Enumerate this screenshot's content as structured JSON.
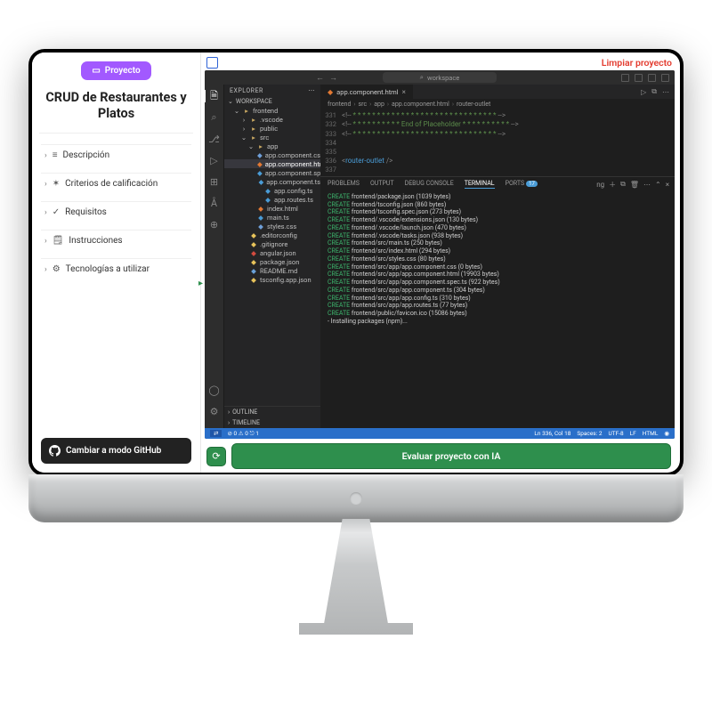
{
  "left": {
    "badge": "Proyecto",
    "title": "CRUD de Restaurantes y Platos",
    "items": [
      {
        "icon": "≡",
        "label": "Descripción"
      },
      {
        "icon": "✶",
        "label": "Criterios de calificación"
      },
      {
        "icon": "✓",
        "label": "Requisitos"
      },
      {
        "icon": "🗒",
        "label": "Instrucciones"
      },
      {
        "icon": "⚙",
        "label": "Tecnologías a utilizar"
      }
    ],
    "github_btn": "Cambiar a modo GitHub"
  },
  "top": {
    "limpiar": "Limpiar proyecto"
  },
  "vscode": {
    "search_placeholder": "workspace",
    "explorer_title": "EXPLORER",
    "workspace_label": "WORKSPACE",
    "outline_label": "OUTLINE",
    "timeline_label": "TIMELINE",
    "tree": [
      {
        "d": 1,
        "kind": "folder",
        "name": "frontend",
        "open": true
      },
      {
        "d": 2,
        "kind": "folder",
        "name": ".vscode",
        "open": false,
        "cls": "fi-fold"
      },
      {
        "d": 2,
        "kind": "folder",
        "name": "public",
        "open": false,
        "cls": "fi-fold"
      },
      {
        "d": 2,
        "kind": "folder",
        "name": "src",
        "open": true,
        "cls": "fi-fold"
      },
      {
        "d": 3,
        "kind": "folder",
        "name": "app",
        "open": true,
        "cls": "fi-fold"
      },
      {
        "d": 4,
        "kind": "file",
        "name": "app.component.css",
        "cls": "fi-css"
      },
      {
        "d": 4,
        "kind": "file",
        "name": "app.component.html",
        "cls": "fi-html",
        "sel": true
      },
      {
        "d": 4,
        "kind": "file",
        "name": "app.component.spec.ts",
        "cls": "fi-ts"
      },
      {
        "d": 4,
        "kind": "file",
        "name": "app.component.ts",
        "cls": "fi-ts"
      },
      {
        "d": 4,
        "kind": "file",
        "name": "app.config.ts",
        "cls": "fi-ts"
      },
      {
        "d": 4,
        "kind": "file",
        "name": "app.routes.ts",
        "cls": "fi-ts"
      },
      {
        "d": 3,
        "kind": "file",
        "name": "index.html",
        "cls": "fi-html"
      },
      {
        "d": 3,
        "kind": "file",
        "name": "main.ts",
        "cls": "fi-ts"
      },
      {
        "d": 3,
        "kind": "file",
        "name": "styles.css",
        "cls": "fi-css"
      },
      {
        "d": 2,
        "kind": "file",
        "name": ".editorconfig",
        "cls": "fi-json"
      },
      {
        "d": 2,
        "kind": "file",
        "name": ".gitignore",
        "cls": "fi-json"
      },
      {
        "d": 2,
        "kind": "file",
        "name": "angular.json",
        "cls": "fi-ng"
      },
      {
        "d": 2,
        "kind": "file",
        "name": "package.json",
        "cls": "fi-json"
      },
      {
        "d": 2,
        "kind": "file",
        "name": "README.md",
        "cls": "fi-md"
      },
      {
        "d": 2,
        "kind": "file",
        "name": "tsconfig.app.json",
        "cls": "fi-json"
      }
    ],
    "tab": {
      "label": "app.component.html"
    },
    "breadcrumb": [
      "frontend",
      "src",
      "app",
      "app.component.html",
      "router-outlet"
    ],
    "code": [
      {
        "n": "331",
        "html": "<span class='punct'>&lt;!--</span><span class='cmt'> * * * * * * * * * * * * * * * * * * * * * * * * * * * * * * </span><span class='punct'>--&gt;</span>"
      },
      {
        "n": "332",
        "html": "<span class='punct'>&lt;!--</span><span class='cmt'> * * * * * * * * * *  End of Placeholder  * * * * * * * * * * </span><span class='punct'>--&gt;</span>"
      },
      {
        "n": "333",
        "html": "<span class='punct'>&lt;!--</span><span class='cmt'> * * * * * * * * * * * * * * * * * * * * * * * * * * * * * * </span><span class='punct'>--&gt;</span>"
      },
      {
        "n": "334",
        "html": ""
      },
      {
        "n": "335",
        "html": ""
      },
      {
        "n": "336",
        "html": "<span class='punct'>&lt;</span><span class='tag'>router-outlet</span> <span class='punct'>/&gt;</span>"
      },
      {
        "n": "337",
        "html": ""
      }
    ],
    "panel": {
      "tabs": [
        "PROBLEMS",
        "OUTPUT",
        "DEBUG CONSOLE",
        "TERMINAL",
        "PORTS"
      ],
      "active": "TERMINAL",
      "ports_badge": "17",
      "shell_label": "ng",
      "lines": [
        "CREATE frontend/package.json (1039 bytes)",
        "CREATE frontend/tsconfig.json (860 bytes)",
        "CREATE frontend/tsconfig.spec.json (273 bytes)",
        "CREATE frontend/.vscode/extensions.json (130 bytes)",
        "CREATE frontend/.vscode/launch.json (470 bytes)",
        "CREATE frontend/.vscode/tasks.json (938 bytes)",
        "CREATE frontend/src/main.ts (250 bytes)",
        "CREATE frontend/src/index.html (294 bytes)",
        "CREATE frontend/src/styles.css (80 bytes)",
        "CREATE frontend/src/app/app.component.css (0 bytes)",
        "CREATE frontend/src/app/app.component.html (19903 bytes)",
        "CREATE frontend/src/app/app.component.spec.ts (922 bytes)",
        "CREATE frontend/src/app/app.component.ts (304 bytes)",
        "CREATE frontend/src/app/app.config.ts (310 bytes)",
        "CREATE frontend/src/app/app.routes.ts (77 bytes)",
        "CREATE frontend/public/favicon.ico (15086 bytes)",
        "- Installing packages (npm)..."
      ]
    },
    "status": {
      "left": "⊘ 0 ⚠ 0   ⎋ 1",
      "right": [
        "Ln 336, Col 18",
        "Spaces: 2",
        "UTF-8",
        "LF",
        "HTML",
        "◉"
      ]
    }
  },
  "eval_btn": "Evaluar proyecto con IA"
}
